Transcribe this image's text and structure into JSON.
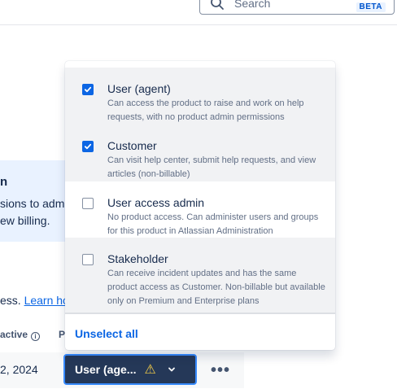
{
  "search": {
    "placeholder": "Search",
    "badge": "BETA"
  },
  "background": {
    "info_title": "n",
    "info_line1": "sions to adm",
    "info_line2": "ew billing.",
    "access_text": "ess.",
    "learn_link": "Learn ho",
    "col_last_active": "active",
    "col_product": "P",
    "row_date": "2, 2024"
  },
  "role_select": {
    "label": "User (age...",
    "warning_icon": "warning-icon"
  },
  "more_button": {
    "label": "•••"
  },
  "dropdown": {
    "options": [
      {
        "title": "User (agent)",
        "desc": "Can access the product to raise and work on help requests, with no product admin permissions",
        "checked": true
      },
      {
        "title": "Customer",
        "desc": "Can visit help center, submit help requests, and view articles (non-billable)",
        "checked": true
      },
      {
        "title": "User access admin",
        "desc": "No product access. Can administer users and groups for this product in Atlassian Administration",
        "checked": false
      },
      {
        "title": "Stakeholder",
        "desc": "Can receive incident updates and has the same product access as Customer. Non-billable but available only on Premium and Enterprise plans",
        "checked": false
      }
    ],
    "unselect_all": "Unselect all"
  },
  "colors": {
    "accent": "#0c66e4",
    "select_bg": "#253858",
    "focus_ring": "#388bff",
    "warning": "#f5cd47"
  }
}
